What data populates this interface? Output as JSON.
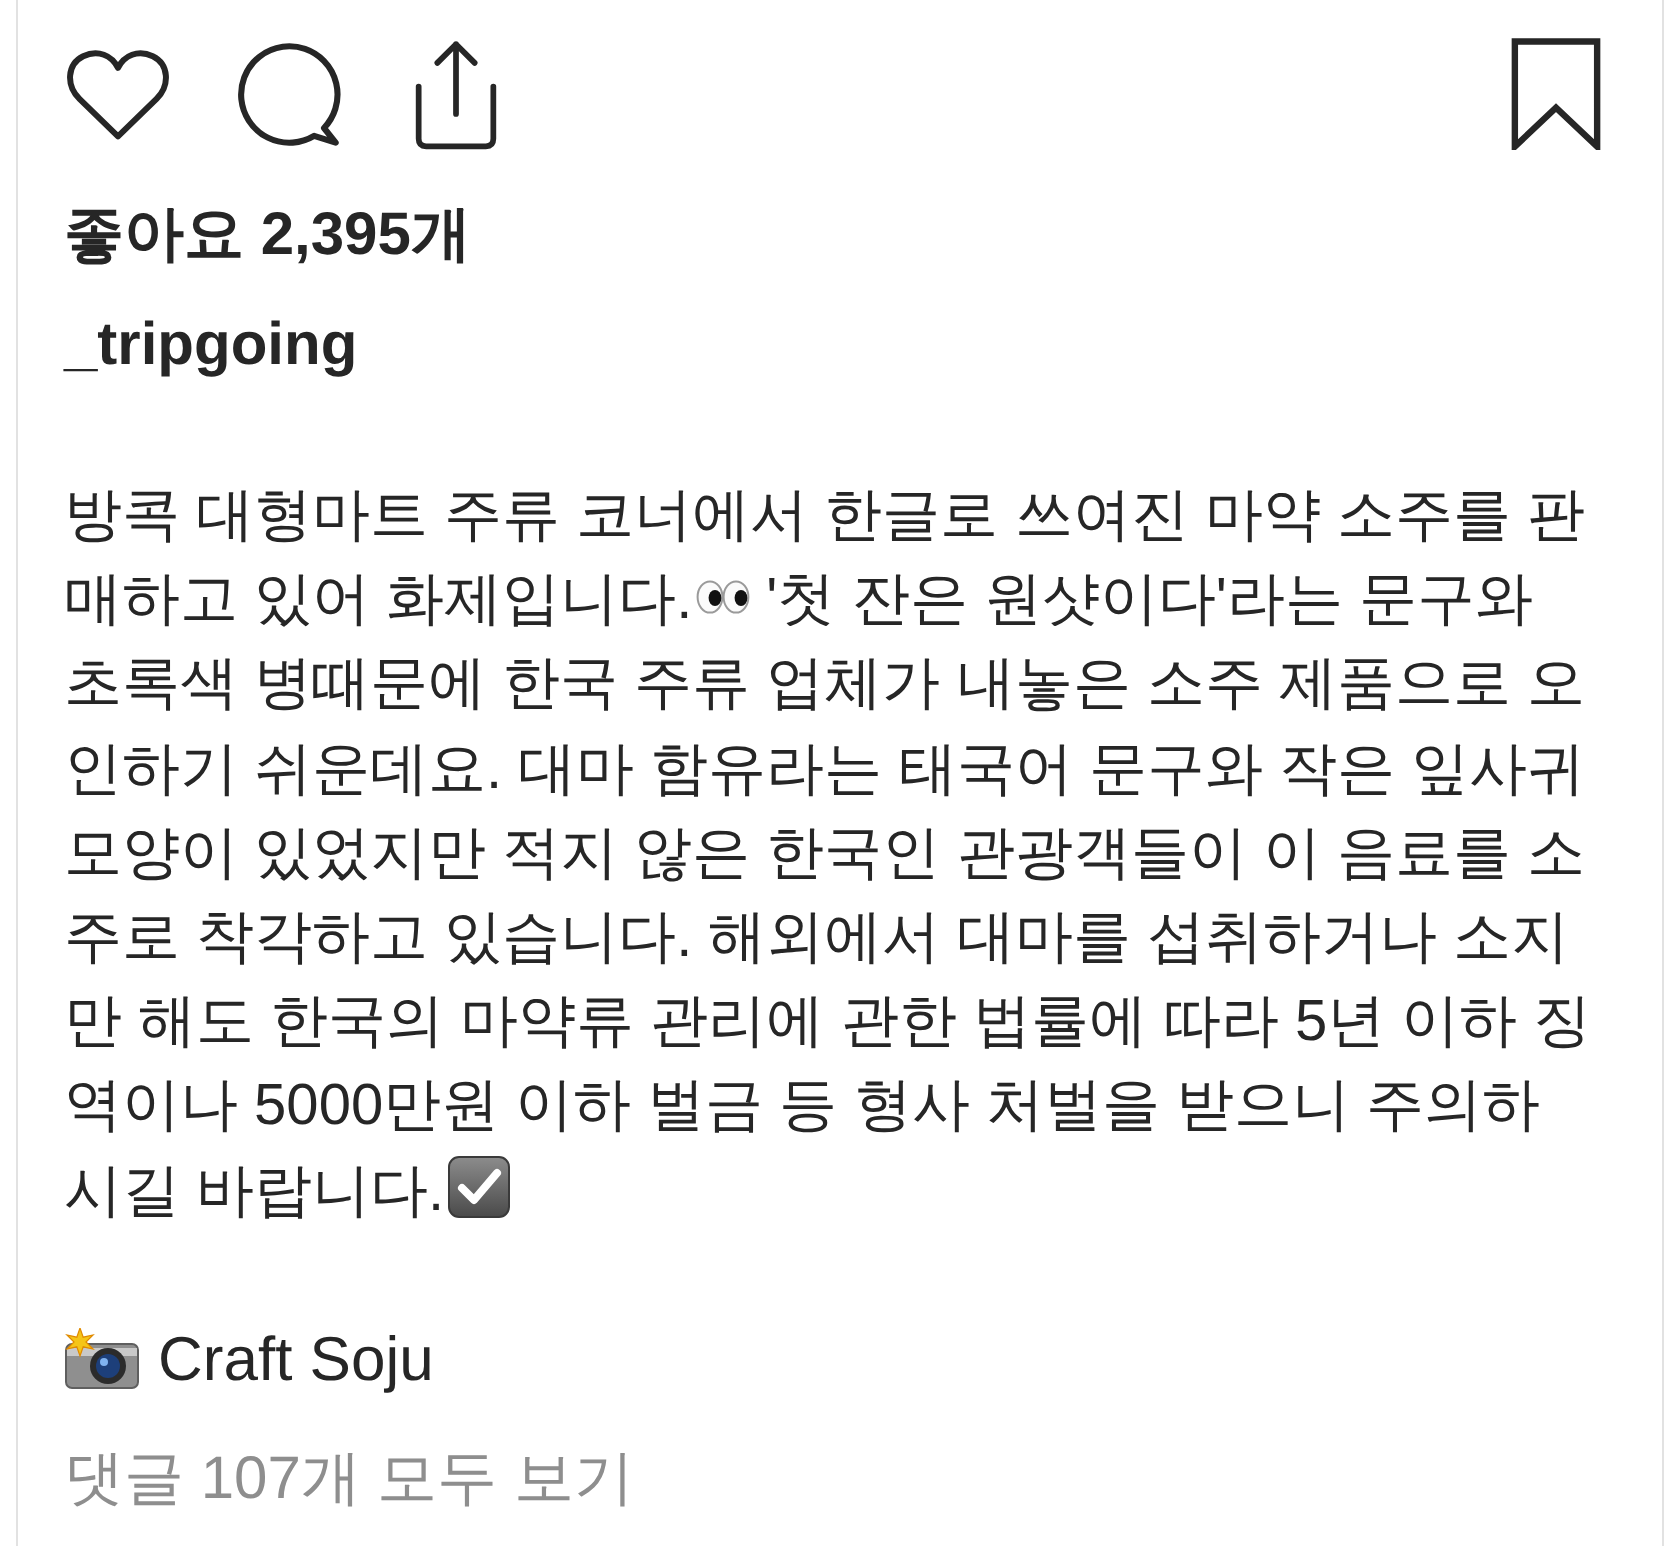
{
  "post_actions": {
    "liked": false,
    "saved": false
  },
  "likes": "좋아요 2,395개",
  "username": "_tripgoing",
  "caption": {
    "lines": [
      {
        "parts": [
          {
            "kind": "text",
            "text": "방콕 대형마트 주류 코너에서 한글로 쓰여진 마약 소주를 판"
          }
        ]
      },
      {
        "parts": [
          {
            "kind": "text",
            "text": "매하고 있어 화제입니다."
          },
          {
            "kind": "eyes"
          },
          {
            "kind": "text",
            "text": "'첫 잔은 원샷이다'라는 문구와"
          }
        ]
      },
      {
        "parts": [
          {
            "kind": "text",
            "text": "초록색 병때문에 한국 주류 업체가 내놓은 소주 제품으로 오"
          }
        ]
      },
      {
        "parts": [
          {
            "kind": "text",
            "text": "인하기 쉬운데요. 대마 함유라는 태국어 문구와 작은 잎사귀"
          }
        ]
      },
      {
        "parts": [
          {
            "kind": "text",
            "text": "모양이 있었지만 적지 않은 한국인 관광객들이 이 음료를 소"
          }
        ]
      },
      {
        "parts": [
          {
            "kind": "text",
            "text": "주로 착각하고 있습니다. 해외에서 대마를 섭취하거나 소지"
          }
        ]
      },
      {
        "parts": [
          {
            "kind": "text",
            "text": "만 해도 한국의 마약류 관리에 관한 법률에 따라 5년 이하 징"
          }
        ]
      },
      {
        "parts": [
          {
            "kind": "text",
            "text": "역이나 5000만원 이하 벌금 등 형사 처벌을 받으니 주의하"
          }
        ]
      },
      {
        "parts": [
          {
            "kind": "text",
            "text": "시길 바랍니다."
          },
          {
            "kind": "check"
          }
        ]
      }
    ]
  },
  "credit": "Craft Soju",
  "comments_link": "댓글 107개 모두 보기"
}
